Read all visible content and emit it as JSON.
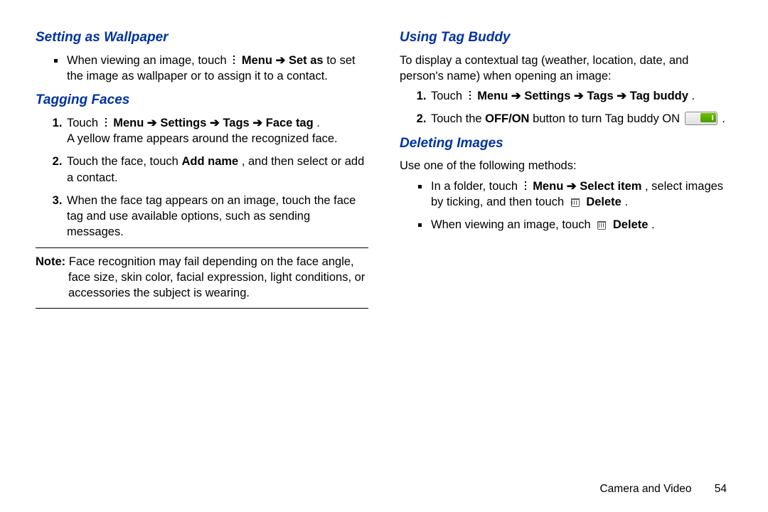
{
  "left": {
    "h_wallpaper": "Setting as Wallpaper",
    "wallpaper_b1_a": "When viewing an image, touch ",
    "wallpaper_b1_menu": "Menu",
    "wallpaper_b1_arrow1": " ➔ ",
    "wallpaper_b1_setas": "Set as",
    "wallpaper_b1_b": " to set the image as wallpaper or to assign it to a contact.",
    "h_tagging": "Tagging Faces",
    "tf1_a": "Touch ",
    "tf1_menu": "Menu",
    "tf1_ar1": " ➔ ",
    "tf1_settings": "Settings",
    "tf1_ar2": " ➔ ",
    "tf1_tags": "Tags",
    "tf1_ar3": " ➔ ",
    "tf1_facetag": "Face tag",
    "tf1_dot": ".",
    "tf1_b": "A yellow frame appears around the recognized face.",
    "tf2_a": "Touch the face, touch ",
    "tf2_add": "Add name",
    "tf2_b": ", and then select or add a contact.",
    "tf3": "When the face tag appears on an image, touch the face tag and use available options, such as sending messages.",
    "note_label": "Note:",
    "note_body": "Face recognition may fail depending on the face angle, face size, skin color, facial expression, light conditions, or accessories the subject is wearing."
  },
  "right": {
    "h_tagbuddy": "Using Tag Buddy",
    "tb_intro": "To display a contextual tag (weather, location, date, and person's name) when opening an image:",
    "tb1_a": "Touch ",
    "tb1_menu": "Menu",
    "tb1_ar1": " ➔ ",
    "tb1_settings": "Settings",
    "tb1_ar2": " ➔ ",
    "tb1_tags": "Tags",
    "tb1_ar3": " ➔ ",
    "tb1_tagbuddy": "Tag buddy",
    "tb1_dot": ".",
    "tb2_a": "Touch the ",
    "tb2_offon": "OFF/ON",
    "tb2_b": " button to turn Tag buddy ON ",
    "tb2_c": ".",
    "h_deleting": "Deleting Images",
    "del_intro": "Use one of the following methods:",
    "del1_a": "In a folder, touch ",
    "del1_menu": "Menu",
    "del1_ar1": " ➔ ",
    "del1_select": "Select item",
    "del1_b": ", select images by ticking, and then touch ",
    "del1_del": "Delete",
    "del1_dot": ".",
    "del2_a": "When viewing an image, touch ",
    "del2_del": "Delete",
    "del2_dot": "."
  },
  "footer": {
    "chapter": "Camera and Video",
    "page": "54"
  }
}
